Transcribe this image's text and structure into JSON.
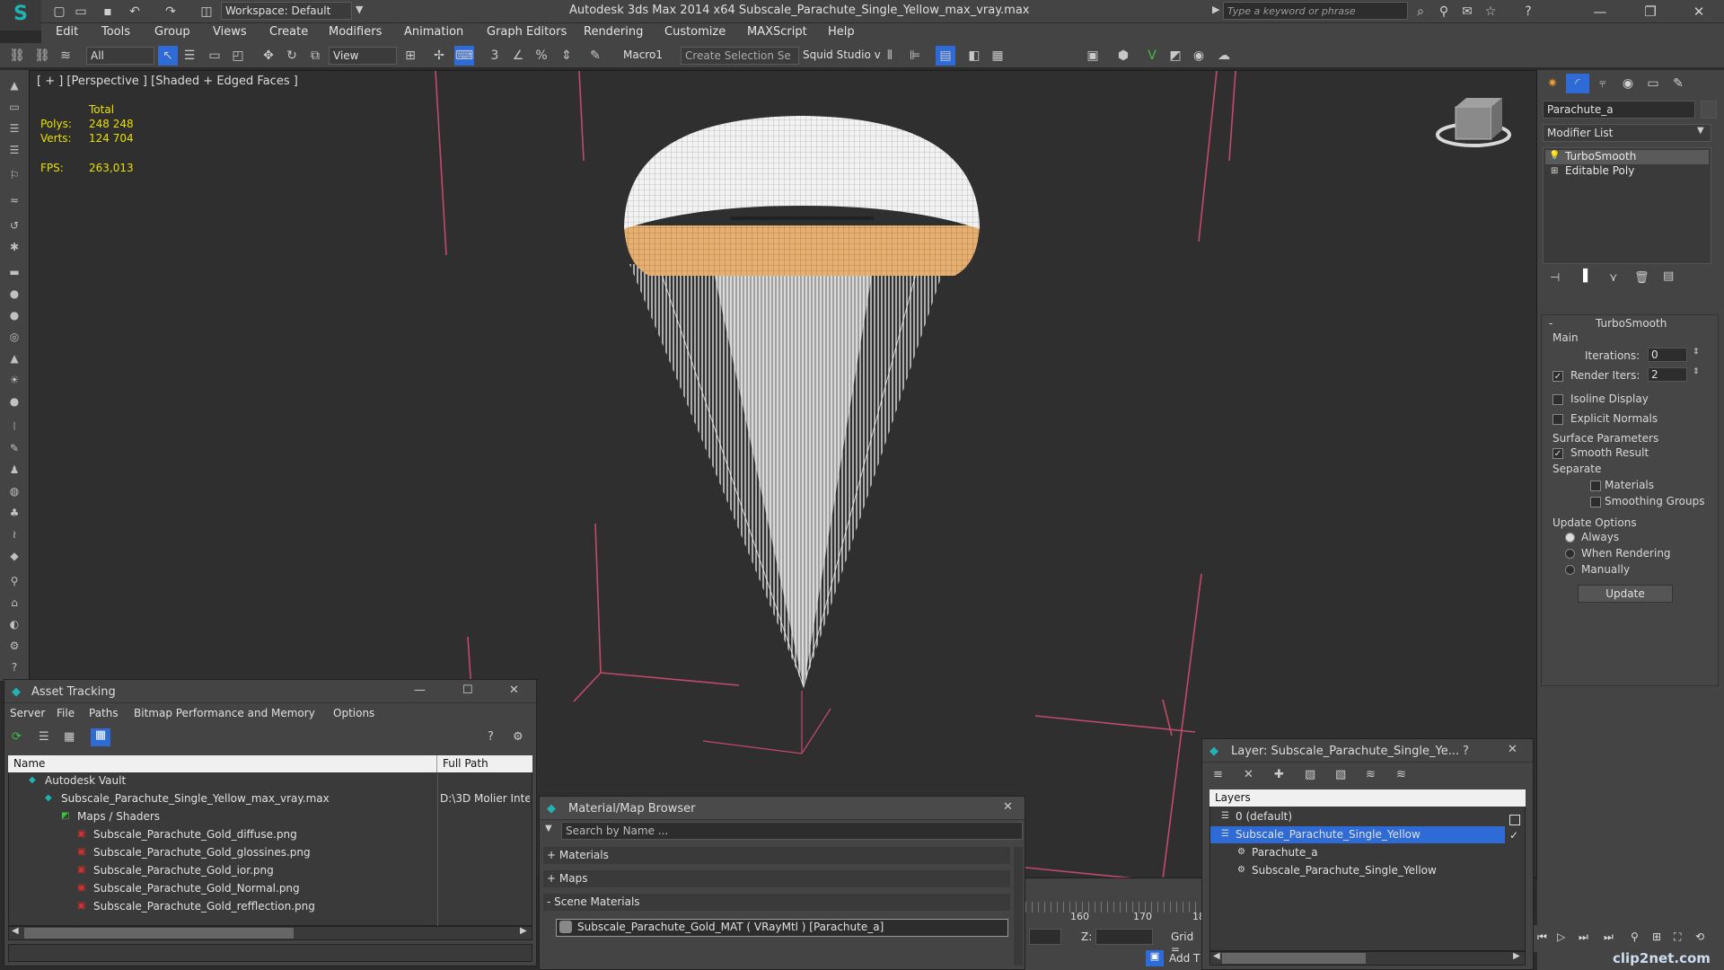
{
  "app": {
    "window_title": "Autodesk 3ds Max  2014 x64    Subscale_Parachute_Single_Yellow_max_vray.max",
    "workspace": "Workspace: Default",
    "search_placeholder": "Type a keyword or phrase"
  },
  "menu": [
    "Edit",
    "Tools",
    "Group",
    "Views",
    "Create",
    "Modifiers",
    "Animation",
    "Graph Editors",
    "Rendering",
    "Customize",
    "MAXScript",
    "Help"
  ],
  "toolbar": {
    "filter": "All",
    "ref_coord": "View",
    "macro": "Macro1",
    "selection_set": "Create Selection Se",
    "squid": "Squid Studio v"
  },
  "viewport": {
    "label": "[ + ] [Perspective ] [Shaded + Edged Faces ]",
    "stats_total": "Total",
    "polys_label": "Polys:",
    "polys_value": "248 248",
    "verts_label": "Verts:",
    "verts_value": "124 704",
    "fps_label": "FPS:",
    "fps_value": "263,013"
  },
  "command_panel": {
    "object_name": "Parachute_a",
    "modifier_list": "Modifier List",
    "stack": [
      "TurboSmooth",
      "Editable Poly"
    ],
    "turbosmooth": {
      "title": "TurboSmooth",
      "main": "Main",
      "iterations_label": "Iterations:",
      "iterations_value": "0",
      "render_iters_label": "Render Iters:",
      "render_iters_value": "2",
      "render_iters_checked": true,
      "isoline": "Isoline Display",
      "explicit_normals": "Explicit Normals",
      "surface_params": "Surface Parameters",
      "smooth_result": "Smooth Result",
      "separate": "Separate",
      "materials": "Materials",
      "smoothing_groups": "Smoothing Groups",
      "update_options": "Update Options",
      "always": "Always",
      "when_rendering": "When Rendering",
      "manually": "Manually",
      "update_btn": "Update"
    }
  },
  "asset_tracking": {
    "title": "Asset Tracking",
    "menu": [
      "Server",
      "File",
      "Paths",
      "Bitmap Performance and Memory",
      "Options"
    ],
    "col_name": "Name",
    "col_path": "Full Path",
    "rows": [
      {
        "name": "Autodesk Vault",
        "path": "",
        "indent": 1
      },
      {
        "name": "Subscale_Parachute_Single_Yellow_max_vray.max",
        "path": "D:\\3D Molier Inte",
        "indent": 2
      },
      {
        "name": "Maps / Shaders",
        "path": "",
        "indent": 3
      },
      {
        "name": "Subscale_Parachute_Gold_diffuse.png",
        "path": "",
        "indent": 4
      },
      {
        "name": "Subscale_Parachute_Gold_glossines.png",
        "path": "",
        "indent": 4
      },
      {
        "name": "Subscale_Parachute_Gold_ior.png",
        "path": "",
        "indent": 4
      },
      {
        "name": "Subscale_Parachute_Gold_Normal.png",
        "path": "",
        "indent": 4
      },
      {
        "name": "Subscale_Parachute_Gold_refflection.png",
        "path": "",
        "indent": 4
      }
    ]
  },
  "material_browser": {
    "title": "Material/Map Browser",
    "search": "Search by Name ...",
    "materials": "+ Materials",
    "maps": "+ Maps",
    "scene_materials": "- Scene Materials",
    "scene_item": "Subscale_Parachute_Gold_MAT  ( VRayMtl )  [Parachute_a]"
  },
  "layer_dialog": {
    "title": "Layer: Subscale_Parachute_Single_Ye...",
    "help": "?",
    "header": "Layers",
    "rows": [
      {
        "name": "0 (default)",
        "indent": 1,
        "selected": false
      },
      {
        "name": "Subscale_Parachute_Single_Yellow",
        "indent": 1,
        "selected": true
      },
      {
        "name": "Parachute_a",
        "indent": 2,
        "selected": false
      },
      {
        "name": "Subscale_Parachute_Single_Yellow",
        "indent": 2,
        "selected": false
      }
    ]
  },
  "timeline": {
    "ticks": [
      "160",
      "170",
      "18"
    ],
    "z_label": "Z:",
    "grid_label": "Grid =",
    "add_t": "Add T"
  },
  "watermark": "clip2net.com",
  "colors": {
    "background": "#2b2b2b",
    "panel": "#444444",
    "viewport": "#2f2f2f",
    "selection": "#2f6bd6",
    "stats": "#e8e000",
    "grid_lines": "#c24a6a",
    "band": "#e8b070"
  }
}
